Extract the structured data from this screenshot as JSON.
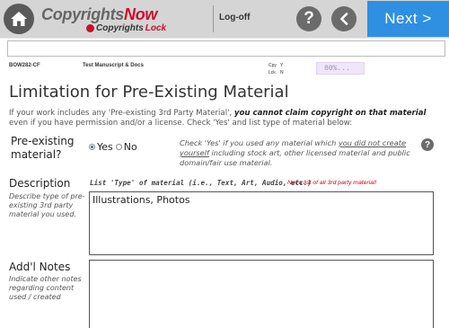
{
  "header": {
    "logo_main_prefix": "Copyrights",
    "logo_main_suffix": "Now",
    "logo_sub_prefix": "Copyrights",
    "logo_sub_suffix": "Lock",
    "logoff_label": "Log-off",
    "help_label": "?",
    "next_label": "Next >",
    "icons": {
      "home": "home-icon",
      "back": "chevron-left-icon",
      "help": "question-icon",
      "lock": "lock-icon"
    },
    "colors": {
      "next_button": "#2f8fe0",
      "brand_red": "#c8102e"
    }
  },
  "meta": {
    "code": "BOW282-CF",
    "doc_title": "Test Manuscript & Docs",
    "cpy_label": "Cpy",
    "cpy_value": "Y",
    "lck_label": "Lck",
    "lck_value": "N",
    "progress_text": "80%..."
  },
  "page": {
    "title": "Limitation for Pre-Existing Material",
    "intro_part1": "If your work includes any 'Pre-existing 3rd Party Material', ",
    "intro_bold": "you cannot claim copyright on that material",
    "intro_part2": "even if you have permission and/or a license.  Check 'Yes' and list type of material below:"
  },
  "question": {
    "label": "Pre-existing material?",
    "yes_label": "Yes",
    "no_label": "No",
    "selected": "Yes",
    "help_part1": "Check 'Yes' if you used any material which ",
    "help_underlined": "you did not create yourself",
    "help_part2": " including stock art, other licensed material and public domain/fair use material."
  },
  "description": {
    "label": "Description",
    "hint": "Describe type of pre-existing 3rd party material you used.",
    "list_type": "List 'Type' of material (i.e., Text, Art, Audio, etc.)",
    "list_note": "Not a list of all 3rd party material!",
    "value": "Illustrations, Photos"
  },
  "notes": {
    "label": "Add'l Notes",
    "hint": "Indicate other notes regarding content used / created",
    "value": ""
  }
}
